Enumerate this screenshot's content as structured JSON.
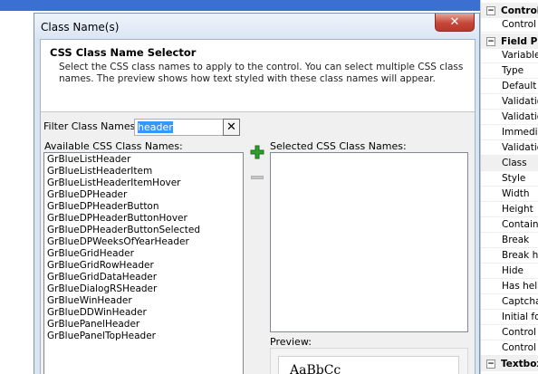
{
  "dialog": {
    "title": "Class Name(s)",
    "close_glyph": "✕",
    "header": {
      "title": "CSS Class Name Selector",
      "description": "Select the CSS class names to apply to the control. You can select multiple CSS class names. The preview shows how text styled with these class names will appear."
    },
    "filter": {
      "label": "Filter Class Names:",
      "value": "header",
      "clear_glyph": "✕"
    },
    "available": {
      "label": "Available CSS Class Names:",
      "items": [
        "GrBlueListHeader",
        "GrBlueListHeaderItem",
        "GrBlueListHeaderItemHover",
        "GrBlueDPHeader",
        "GrBlueDPHeaderButton",
        "GrBlueDPHeaderButtonHover",
        "GrBlueDPHeaderButtonSelected",
        "GrBlueDPWeeksOfYearHeader",
        "GrBlueGridHeader",
        "GrBlueGridRowHeader",
        "GrBlueGridDataHeader",
        "GrBlueDialogRSHeader",
        "GrBlueWinHeader",
        "GrBlueDDWinHeader",
        "GrBluePanelHeader",
        "GrBluePanelTopHeader"
      ]
    },
    "selected": {
      "label": "Selected CSS Class Names:"
    },
    "preview": {
      "label": "Preview:",
      "sample": "AaBbCc"
    }
  },
  "property_grid": {
    "rows": [
      {
        "kind": "category",
        "label": "Control",
        "expander": "−"
      },
      {
        "kind": "prop",
        "label": "Control ty"
      },
      {
        "kind": "category",
        "label": "Field Pr",
        "expander": "−"
      },
      {
        "kind": "prop",
        "label": "Variable"
      },
      {
        "kind": "prop",
        "label": "Type"
      },
      {
        "kind": "prop",
        "label": "Default v"
      },
      {
        "kind": "prop",
        "label": "Validatio"
      },
      {
        "kind": "prop",
        "label": "Validatio"
      },
      {
        "kind": "prop",
        "label": "Immediat"
      },
      {
        "kind": "prop",
        "label": "Validatio"
      },
      {
        "kind": "prop",
        "label": "Class",
        "selected": true
      },
      {
        "kind": "prop",
        "label": "Style"
      },
      {
        "kind": "prop",
        "label": "Width"
      },
      {
        "kind": "prop",
        "label": "Height"
      },
      {
        "kind": "prop",
        "label": "Containe"
      },
      {
        "kind": "prop",
        "label": "Break"
      },
      {
        "kind": "prop",
        "label": "Break he"
      },
      {
        "kind": "prop",
        "label": "Hide"
      },
      {
        "kind": "prop",
        "label": "Has help"
      },
      {
        "kind": "prop",
        "label": "Captcha"
      },
      {
        "kind": "prop",
        "label": "Initial foc"
      },
      {
        "kind": "prop",
        "label": "Control c"
      },
      {
        "kind": "prop",
        "label": "Control c"
      },
      {
        "kind": "category",
        "label": "Textbox",
        "expander": "−"
      }
    ]
  },
  "colors": {
    "dialog_frame": "#d8e4f2",
    "close_button": "#c5473a",
    "selection": "#3399ff",
    "add_icon": "#2e9e2e"
  }
}
